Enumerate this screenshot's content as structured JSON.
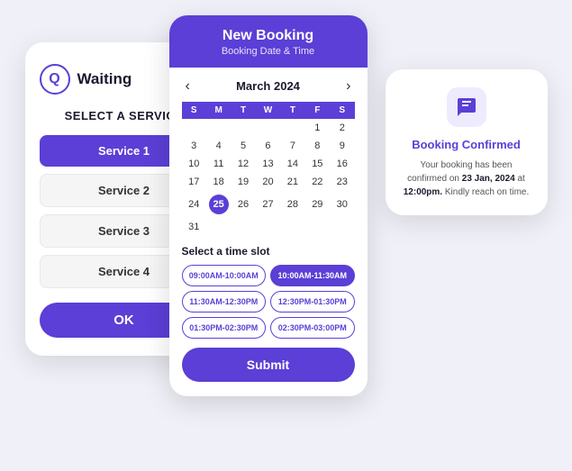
{
  "service_card": {
    "logo_text": "Waiting",
    "title": "SELECT A SERVICE",
    "services": [
      {
        "label": "Service 1",
        "active": true
      },
      {
        "label": "Service 2",
        "active": false
      },
      {
        "label": "Service 3",
        "active": false
      },
      {
        "label": "Service 4",
        "active": false
      }
    ],
    "ok_label": "OK"
  },
  "booking_card": {
    "title": "New Booking",
    "subtitle": "Booking Date & Time",
    "month": "March 2024",
    "prev_label": "‹",
    "next_label": "›",
    "days_header": [
      "S",
      "M",
      "T",
      "W",
      "T",
      "F",
      "S"
    ],
    "weeks": [
      [
        "",
        "",
        "",
        "",
        "",
        "1",
        "2"
      ],
      [
        "3",
        "4",
        "5",
        "6",
        "7",
        "8",
        "9"
      ],
      [
        "10",
        "11",
        "12",
        "13",
        "14",
        "15",
        "16"
      ],
      [
        "17",
        "18",
        "19",
        "20",
        "21",
        "22",
        "23"
      ],
      [
        "24",
        "25",
        "26",
        "27",
        "28",
        "29",
        "30"
      ],
      [
        "31",
        "",
        "",
        "",
        "",
        "",
        ""
      ]
    ],
    "today": "25",
    "time_slot_label": "Select a time slot",
    "time_slots": [
      {
        "label": "09:00AM-10:00AM",
        "filled": false
      },
      {
        "label": "10:00AM-11:30AM",
        "filled": true
      },
      {
        "label": "11:30AM-12:30PM",
        "filled": false
      },
      {
        "label": "12:30PM-01:30PM",
        "filled": false
      },
      {
        "label": "01:30PM-02:30PM",
        "filled": false
      },
      {
        "label": "02:30PM-03:00PM",
        "filled": false
      }
    ],
    "submit_label": "Submit"
  },
  "confirmed_card": {
    "title": "Booking Confirmed",
    "message": "Your booking has been confirmed on ",
    "date": "23 Jan, 2024",
    "at": " at ",
    "time": "12:00pm.",
    "note": " Kindly reach on time."
  }
}
